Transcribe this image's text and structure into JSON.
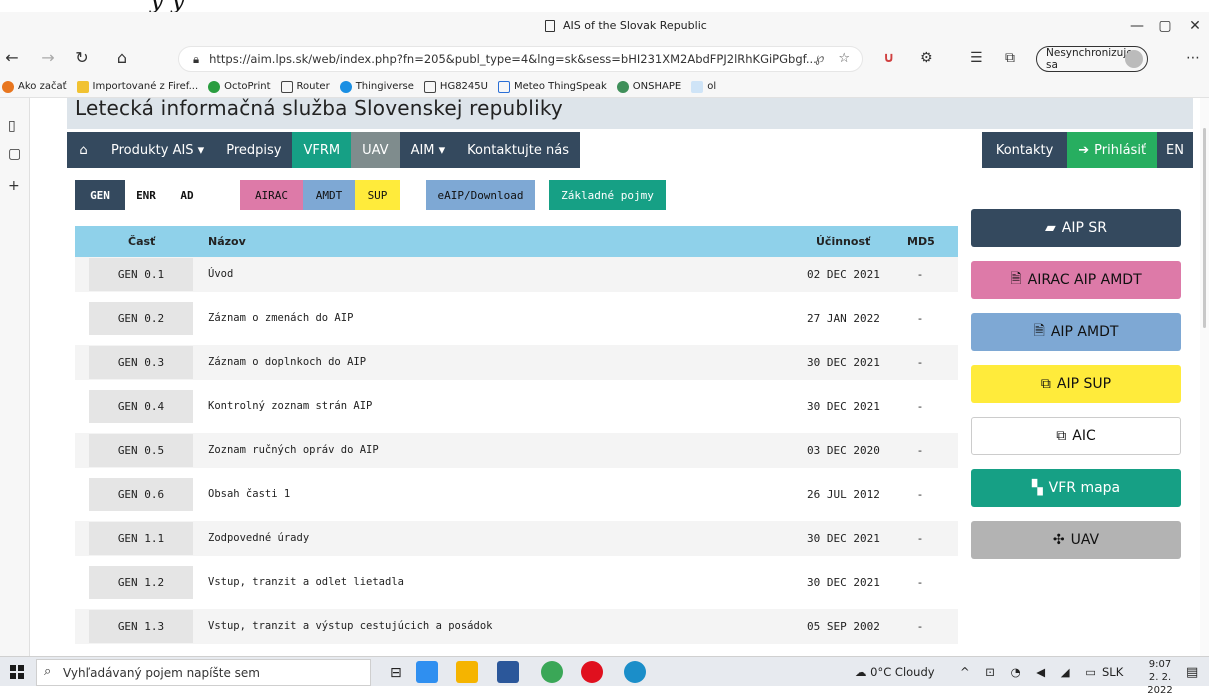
{
  "browser": {
    "window_title": "AIS of the Slovak Republic",
    "url": "https://aim.lps.sk/web/index.php?fn=205&publ_type=4&lng=sk&sess=bHI231XM2AbdFPJ2lRhKGiPGbgf...",
    "sync_label": "Nesynchronizuje sa",
    "bookmarks": [
      "Ako začať",
      "Importované z Firef...",
      "OctoPrint",
      "Router",
      "Thingiverse",
      "HG8245U",
      "Meteo ThingSpeak",
      "ONSHAPE",
      "ol"
    ]
  },
  "site": {
    "header_title": "Letecká informačná služba Slovenskej republiky",
    "nav": {
      "produkty": "Produkty AIS ▾",
      "predpisy": "Predpisy",
      "vfrm": "VFRM",
      "uav": "UAV",
      "aim": "AIM ▾",
      "kontaktujte": "Kontaktujte nás",
      "kontakty": "Kontakty",
      "prihlasit": "Prihlásiť",
      "lang": "EN"
    },
    "sections": [
      "GEN",
      "ENR",
      "AD"
    ],
    "filters": [
      "AIRAC",
      "AMDT",
      "SUP"
    ],
    "eaip": "eAIP/Download",
    "pojmy": "Základné pojmy"
  },
  "table": {
    "headers": {
      "part": "Časť",
      "name": "Názov",
      "effective": "Účinnosť",
      "md5": "MD5"
    },
    "rows": [
      {
        "code": "GEN 0.1",
        "name": "Úvod",
        "date": "02 DEC 2021",
        "md5": "-"
      },
      {
        "code": "GEN 0.2",
        "name": "Záznam o zmenách do AIP",
        "date": "27 JAN 2022",
        "md5": "-"
      },
      {
        "code": "GEN 0.3",
        "name": "Záznam o doplnkoch do AIP",
        "date": "30 DEC 2021",
        "md5": "-"
      },
      {
        "code": "GEN 0.4",
        "name": "Kontrolný zoznam strán AIP",
        "date": "30 DEC 2021",
        "md5": "-"
      },
      {
        "code": "GEN 0.5",
        "name": "Zoznam ručných opráv do AIP",
        "date": "03 DEC 2020",
        "md5": "-"
      },
      {
        "code": "GEN 0.6",
        "name": "Obsah časti 1",
        "date": "26 JUL 2012",
        "md5": "-"
      },
      {
        "code": "GEN 1.1",
        "name": "Zodpovedné úrady",
        "date": "30 DEC 2021",
        "md5": "-"
      },
      {
        "code": "GEN 1.2",
        "name": "Vstup, tranzit a odlet lietadla",
        "date": "30 DEC 2021",
        "md5": "-"
      },
      {
        "code": "GEN 1.3",
        "name": "Vstup, tranzit a výstup cestujúcich a posádok",
        "date": "05 SEP 2002",
        "md5": "-"
      }
    ]
  },
  "side_buttons": [
    {
      "label": "AIP SR",
      "icon": "book-icon",
      "color": "#34495e",
      "text_color": "#ffffff"
    },
    {
      "label": "AIRAC AIP AMDT",
      "icon": "document-icon",
      "color": "#dd7aa8",
      "text_color": "#111111"
    },
    {
      "label": "AIP AMDT",
      "icon": "document-icon",
      "color": "#7ea8d4",
      "text_color": "#111111"
    },
    {
      "label": "AIP SUP",
      "icon": "copy-icon",
      "color": "#ffeb3b",
      "text_color": "#111111"
    },
    {
      "label": "AIC",
      "icon": "copy-icon",
      "color": "#ffffff",
      "text_color": "#111111"
    },
    {
      "label": "VFR mapa",
      "icon": "map-icon",
      "color": "#16a085",
      "text_color": "#ffffff"
    },
    {
      "label": "UAV",
      "icon": "drone-icon",
      "color": "#b3b3b3",
      "text_color": "#111111"
    }
  ],
  "taskbar": {
    "search_placeholder": "Vyhľadávaný pojem napíšte sem",
    "weather": "0°C Cloudy",
    "language": "SLK",
    "time": "9:07",
    "date": "2. 2. 2022"
  }
}
